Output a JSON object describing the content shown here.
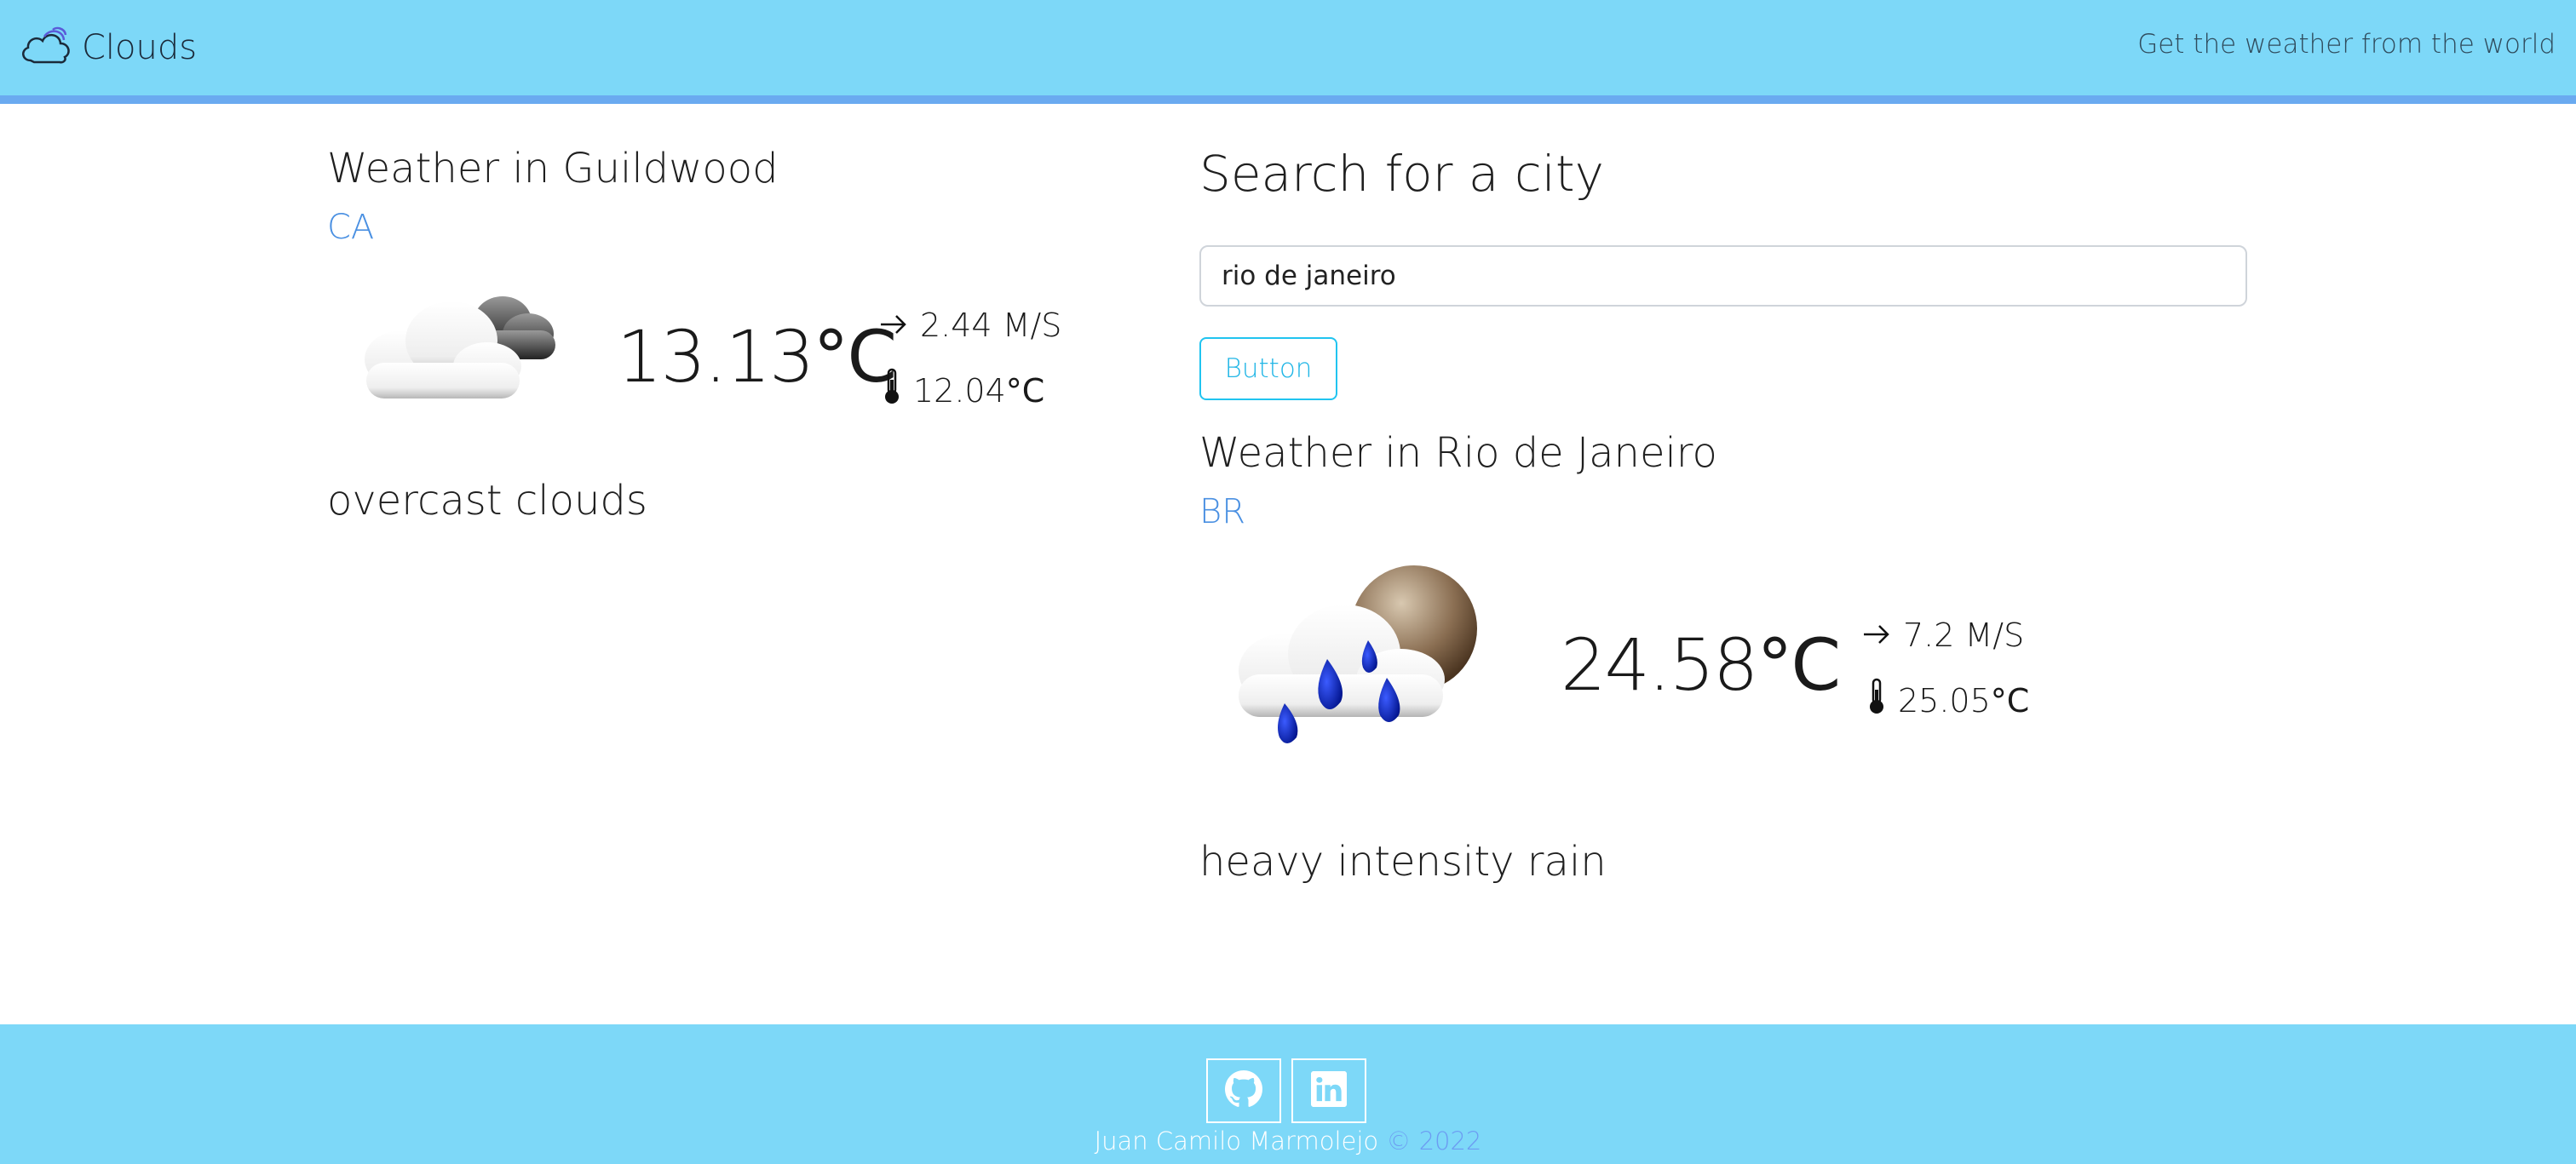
{
  "navbar": {
    "brand": "Clouds",
    "tagline": "Get the weather from the world",
    "brand_icon": "cloud-icon"
  },
  "current_location": {
    "title": "Weather in Guildwood",
    "country": "CA",
    "temperature": "13.13",
    "temp_unit": "°C",
    "wind": "2.44 M/S",
    "feels_like": "12.04",
    "feels_unit": "°C",
    "description": "overcast clouds",
    "icon": "overcast-clouds-icon"
  },
  "search": {
    "title": "Search for a city",
    "input_value": "rio de janeiro",
    "button_label": "Button"
  },
  "searched_location": {
    "title": "Weather in Rio de Janeiro",
    "country": "BR",
    "temperature": "24.58",
    "temp_unit": "°C",
    "wind": "7.2 M/S",
    "feels_like": "25.05",
    "feels_unit": "°C",
    "description": "heavy intensity rain",
    "icon": "heavy-rain-icon"
  },
  "footer": {
    "author": "Juan Camilo Marmolejo ",
    "year": "© 2022",
    "links": [
      "github-icon",
      "linkedin-icon"
    ]
  },
  "colors": {
    "navbar_bg": "#7dd8f8",
    "navbar_border": "#6aaaf0",
    "country_blue": "#4a90e2",
    "button_cyan": "#21c4f0"
  }
}
